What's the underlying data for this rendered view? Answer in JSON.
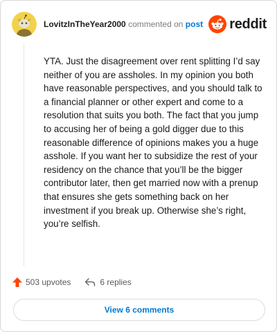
{
  "comment": {
    "username": "LovitzInTheYear2000",
    "action_text": "commented on",
    "post_link_text": "post",
    "body": "YTA. Just the disagreement over rent splitting I’d say neither of you are assholes. In my opinion you both have reasonable perspectives, and you should talk to a financial planner or other expert and come to a resolution that suits you both. The fact that you jump to accusing her of being a gold digger due to this reasonable difference of opinions makes you a huge asshole. If you want her to subsidize the rest of your residency on the chance that you’ll be the bigger contributor later, then get married now with a prenup that ensures she gets something back on her investment if you break up. Otherwise she’s right, you’re selfish."
  },
  "brand": {
    "name": "reddit",
    "color": "#ff4500"
  },
  "stats": {
    "upvotes": "503 upvotes",
    "replies": "6 replies"
  },
  "buttons": {
    "view_comments": "View 6 comments"
  },
  "icons": {
    "avatar": "snoo-avatar-icon",
    "logo": "reddit-logo-icon",
    "upvote": "upvote-arrow-icon",
    "reply": "reply-arrow-icon"
  },
  "colors": {
    "link": "#0079d3",
    "upvote": "#ff4500"
  }
}
